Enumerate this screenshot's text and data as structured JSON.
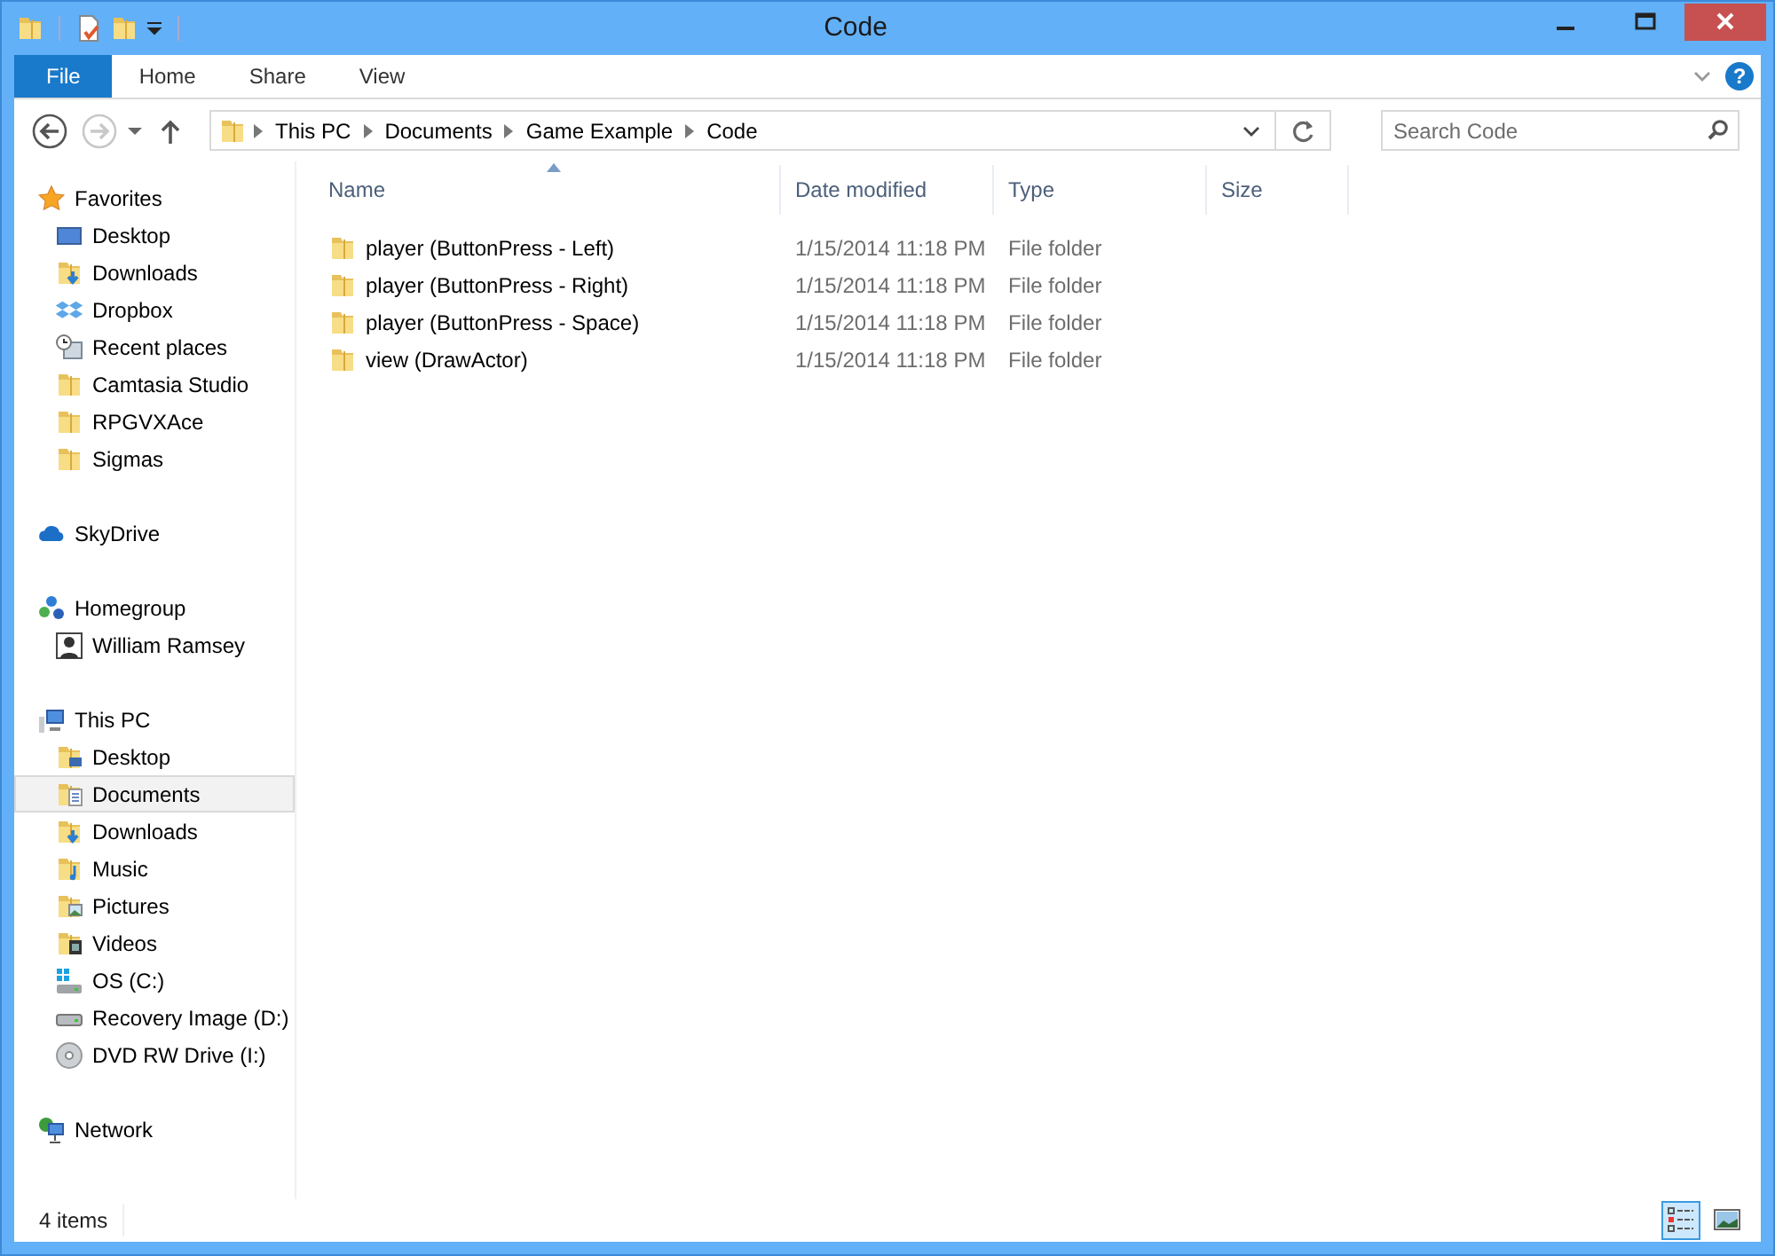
{
  "window": {
    "title": "Code"
  },
  "ribbon": {
    "tabs": [
      {
        "label": "File",
        "kind": "file"
      },
      {
        "label": "Home",
        "kind": "tab"
      },
      {
        "label": "Share",
        "kind": "tab"
      },
      {
        "label": "View",
        "kind": "tab"
      }
    ],
    "help": "?"
  },
  "navigation": {
    "back_disabled": false,
    "forward_disabled": true
  },
  "address": {
    "path": [
      "This PC",
      "Documents",
      "Game Example",
      "Code"
    ]
  },
  "search": {
    "placeholder": "Search Code"
  },
  "sidebar": {
    "groups": [
      {
        "label": "Favorites",
        "kind": "star",
        "selected": false,
        "children": [
          {
            "label": "Desktop",
            "kind": "monitor",
            "selected": false
          },
          {
            "label": "Downloads",
            "kind": "folder-down",
            "selected": false
          },
          {
            "label": "Dropbox",
            "kind": "dropbox",
            "selected": false
          },
          {
            "label": "Recent places",
            "kind": "recent",
            "selected": false
          },
          {
            "label": "Camtasia Studio",
            "kind": "folder",
            "selected": false
          },
          {
            "label": "RPGVXAce",
            "kind": "folder",
            "selected": false
          },
          {
            "label": "Sigmas",
            "kind": "folder",
            "selected": false
          }
        ]
      },
      {
        "label": "SkyDrive",
        "kind": "cloud",
        "selected": false
      },
      {
        "label": "Homegroup",
        "kind": "homegroup",
        "selected": false,
        "children": [
          {
            "label": "William Ramsey",
            "kind": "user",
            "selected": false
          }
        ]
      },
      {
        "label": "This PC",
        "kind": "pc",
        "selected": false,
        "children": [
          {
            "label": "Desktop",
            "kind": "folder-desktop",
            "selected": false
          },
          {
            "label": "Documents",
            "kind": "folder-docs",
            "selected": true
          },
          {
            "label": "Downloads",
            "kind": "folder-down",
            "selected": false
          },
          {
            "label": "Music",
            "kind": "folder-music",
            "selected": false
          },
          {
            "label": "Pictures",
            "kind": "folder-pictures",
            "selected": false
          },
          {
            "label": "Videos",
            "kind": "folder-videos",
            "selected": false
          },
          {
            "label": "OS (C:)",
            "kind": "drive-os",
            "selected": false
          },
          {
            "label": "Recovery Image (D:)",
            "kind": "drive",
            "selected": false
          },
          {
            "label": "DVD RW Drive (I:)",
            "kind": "dvd",
            "selected": false
          }
        ]
      },
      {
        "label": "Network",
        "kind": "network",
        "selected": false
      }
    ]
  },
  "table": {
    "columns": [
      {
        "label": "Name",
        "sorted": true
      },
      {
        "label": "Date modified",
        "sorted": false
      },
      {
        "label": "Type",
        "sorted": false
      },
      {
        "label": "Size",
        "sorted": false
      }
    ],
    "rows": [
      {
        "name": "player (ButtonPress - Left)",
        "date": "1/15/2014 11:18 PM",
        "type": "File folder"
      },
      {
        "name": "player (ButtonPress - Right)",
        "date": "1/15/2014 11:18 PM",
        "type": "File folder"
      },
      {
        "name": "player (ButtonPress - Space)",
        "date": "1/15/2014 11:18 PM",
        "type": "File folder"
      },
      {
        "name": "view (DrawActor)",
        "date": "1/15/2014 11:18 PM",
        "type": "File folder"
      }
    ]
  },
  "status_bar": {
    "text": "4 items",
    "views": [
      {
        "kind": "details",
        "selected": true
      },
      {
        "kind": "tiles",
        "selected": false
      }
    ]
  }
}
